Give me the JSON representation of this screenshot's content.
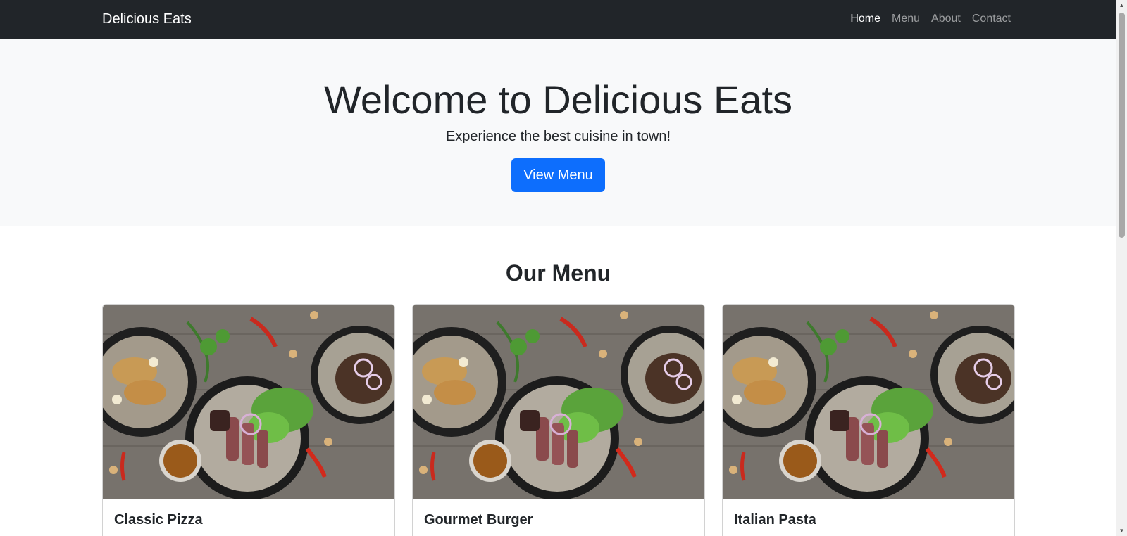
{
  "navbar": {
    "brand": "Delicious Eats",
    "links": [
      "Home",
      "Menu",
      "About",
      "Contact"
    ],
    "active": "Home"
  },
  "hero": {
    "title": "Welcome to Delicious Eats",
    "subtitle": "Experience the best cuisine in town!",
    "button_label": "View Menu"
  },
  "menu_section": {
    "title": "Our Menu",
    "items": [
      {
        "title": "Classic Pizza"
      },
      {
        "title": "Gourmet Burger"
      },
      {
        "title": "Italian Pasta"
      }
    ]
  },
  "colors": {
    "navbar_bg": "#212529",
    "hero_bg": "#f8f9fa",
    "primary": "#0d6efd"
  },
  "icons": {
    "scroll_up": "▲",
    "scroll_down": "▼"
  }
}
